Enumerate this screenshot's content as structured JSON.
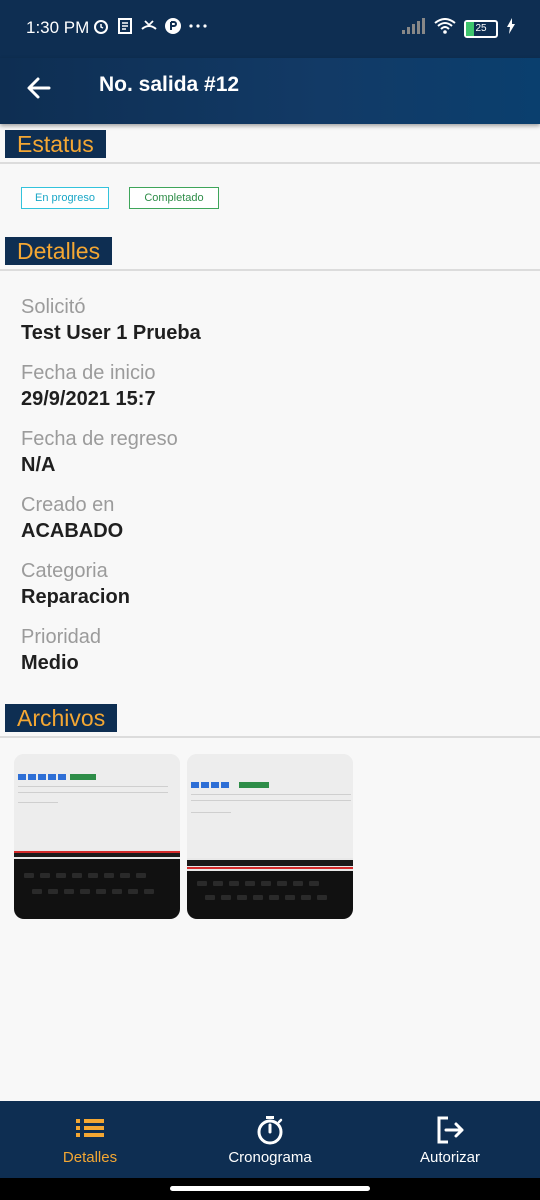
{
  "status_bar": {
    "time": "1:30 PM",
    "battery": "25"
  },
  "header": {
    "title": "No. salida #12"
  },
  "sections": {
    "status": "Estatus",
    "details": "Detalles",
    "files": "Archivos"
  },
  "status_chips": {
    "in_progress": "En progreso",
    "completed": "Completado"
  },
  "details": [
    {
      "label": "Solicitó",
      "value": "Test User 1 Prueba"
    },
    {
      "label": "Fecha de inicio",
      "value": "29/9/2021 15:7"
    },
    {
      "label": "Fecha de regreso",
      "value": "N/A"
    },
    {
      "label": "Creado en",
      "value": "ACABADO"
    },
    {
      "label": "Categoria",
      "value": "Reparacion"
    },
    {
      "label": "Prioridad",
      "value": "Medio"
    }
  ],
  "bottom_nav": {
    "items": [
      {
        "label": "Detalles",
        "icon": "list-icon",
        "active": true
      },
      {
        "label": "Cronograma",
        "icon": "stopwatch-icon",
        "active": false
      },
      {
        "label": "Autorizar",
        "icon": "logout-icon",
        "active": false
      }
    ]
  },
  "colors": {
    "primary": "#0e2e52",
    "accent": "#f4a733",
    "chip_progress": "#33c3dc",
    "chip_completed": "#3ea55a"
  }
}
